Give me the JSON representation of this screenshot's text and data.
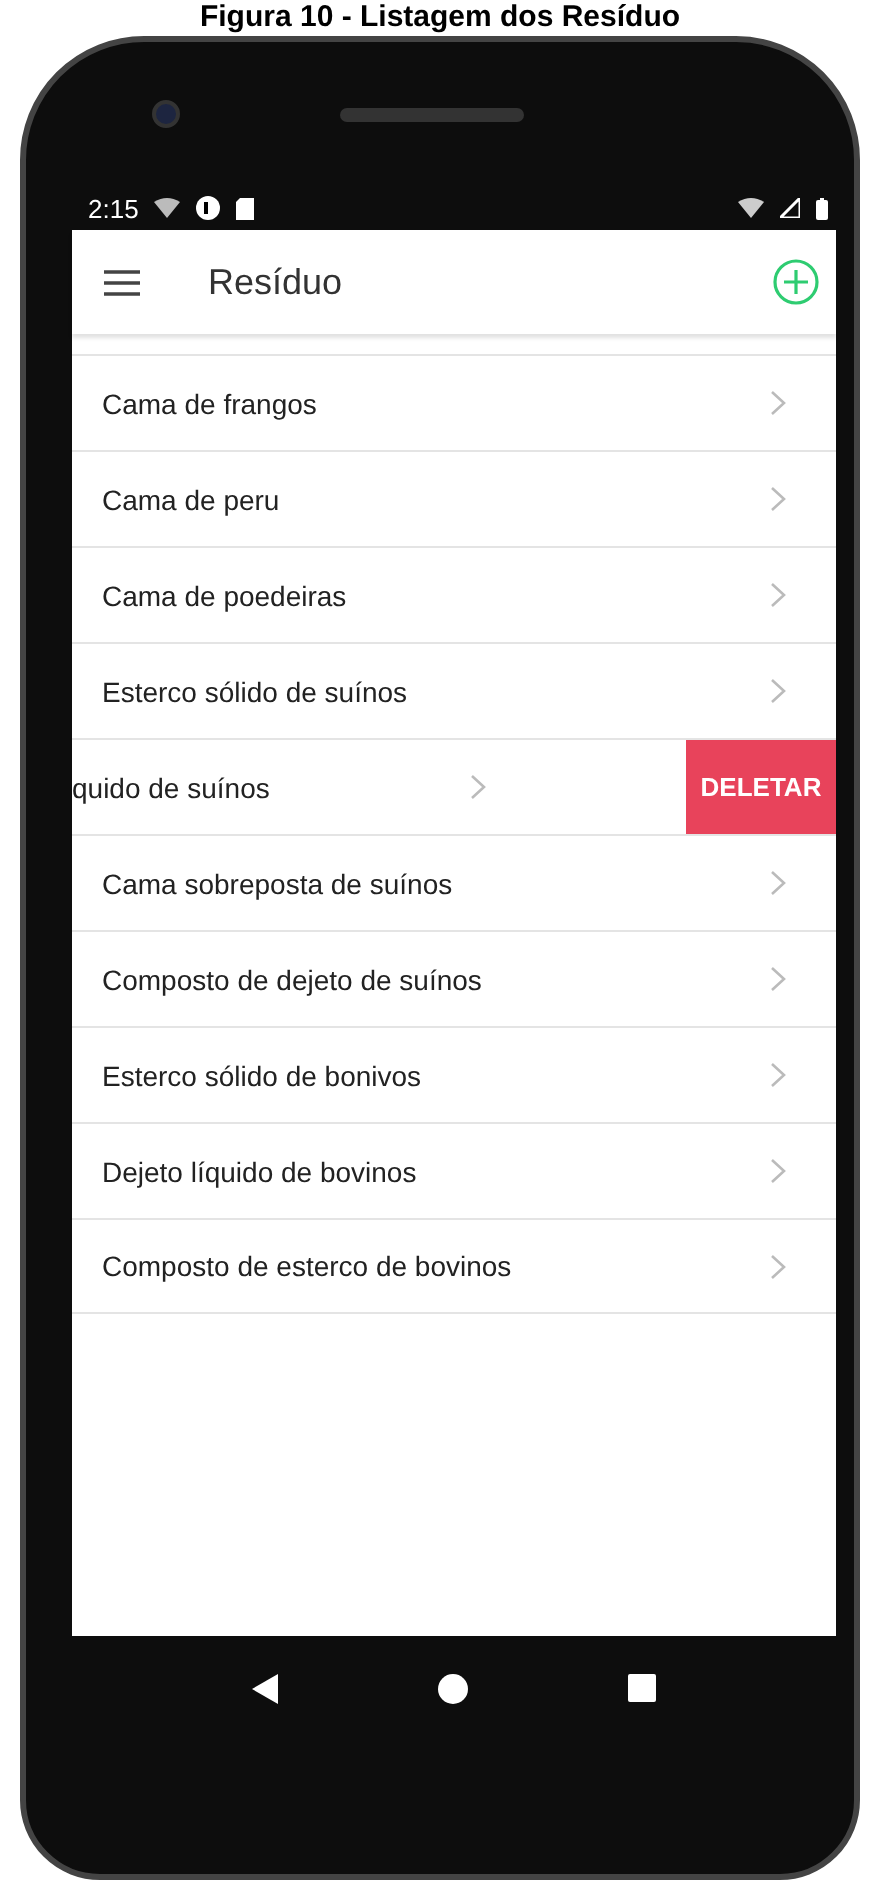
{
  "caption": "Figura 10 - Listagem dos Resíduo",
  "status_bar": {
    "time": "2:15"
  },
  "app_bar": {
    "title": "Resíduo"
  },
  "items": [
    {
      "label": "Cama de frangos",
      "swiped": false
    },
    {
      "label": "Cama de peru",
      "swiped": false
    },
    {
      "label": "Cama de poedeiras",
      "swiped": false
    },
    {
      "label": "Esterco sólido de suínos",
      "swiped": false
    },
    {
      "label": "quido de suínos",
      "swiped": true,
      "action": "DELETAR"
    },
    {
      "label": "Cama sobreposta de suínos",
      "swiped": false
    },
    {
      "label": "Composto de dejeto de suínos",
      "swiped": false
    },
    {
      "label": "Esterco sólido de bonivos",
      "swiped": false
    },
    {
      "label": "Dejeto líquido de bovinos",
      "swiped": false
    },
    {
      "label": "Composto de esterco de bovinos",
      "swiped": false
    }
  ]
}
